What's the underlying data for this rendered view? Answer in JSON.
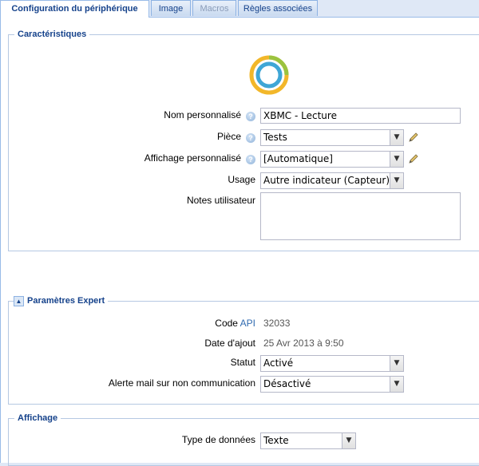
{
  "tabs": [
    "Configuration du périphérique",
    "Image",
    "Macros",
    "Règles associées"
  ],
  "section1": {
    "title": "Caractéristiques",
    "name_label": "Nom personnalisé",
    "name_value": "XBMC - Lecture",
    "room_label": "Pièce",
    "room_value": "Tests",
    "display_label": "Affichage personnalisé",
    "display_value": "[Automatique]",
    "usage_label": "Usage",
    "usage_value": "Autre indicateur (Capteur)",
    "notes_label": "Notes utilisateur",
    "notes_value": ""
  },
  "section2": {
    "title": "Paramètres Expert",
    "code_label": "Code",
    "code_api": "API",
    "code_value": "32033",
    "date_label": "Date d'ajout",
    "date_value": "25 Avr 2013 à 9:50",
    "status_label": "Statut",
    "status_value": "Activé",
    "alert_label": "Alerte mail sur non communication",
    "alert_value": "Désactivé"
  },
  "section3": {
    "title": "Affichage",
    "type_label": "Type de données",
    "type_value": "Texte"
  },
  "icons": {
    "help": "help-icon",
    "edit": "pencil-icon",
    "device": "device-ring-icon",
    "collapse": "collapse-icon"
  },
  "colors": {
    "accent": "#15428b",
    "ring_outer": "#f2b72a",
    "ring_green": "#9bc33f",
    "ring_inner": "#3fa6d6"
  }
}
